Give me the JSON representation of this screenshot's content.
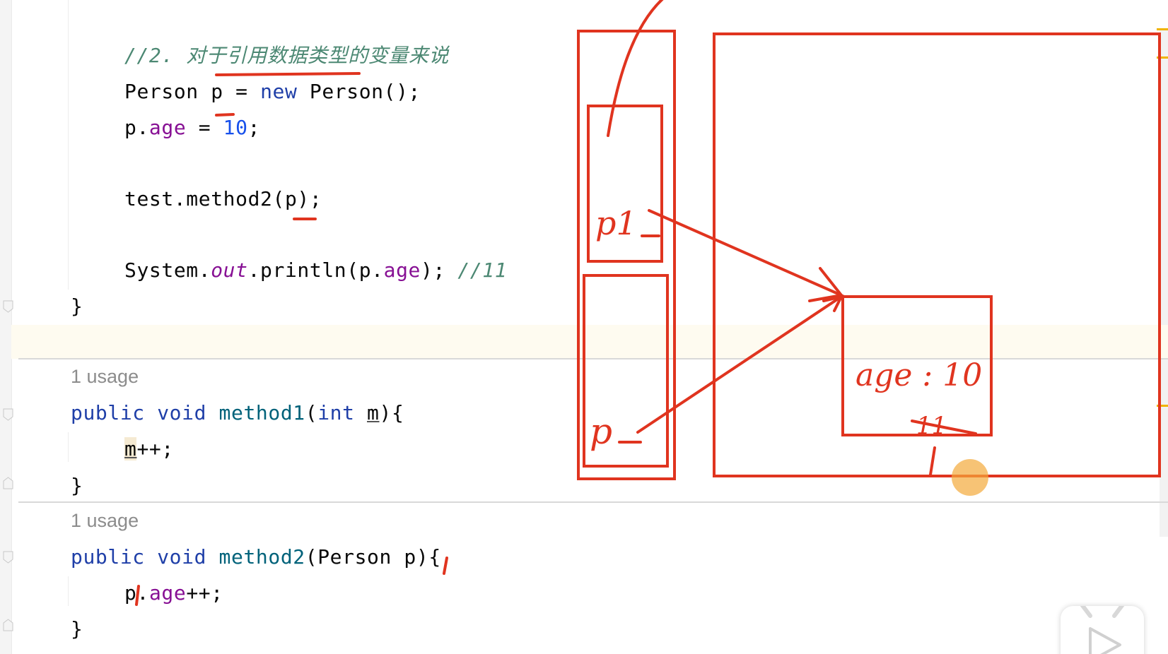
{
  "editor": {
    "comment_line": "//2. 对于引用数据类型的变量来说",
    "line_person": {
      "type": "Person",
      "var": "p",
      "eq": " = ",
      "kw_new": "new",
      "ctor": " Person();"
    },
    "line_age": {
      "obj": "p.",
      "field": "age",
      "eq": " = ",
      "num": "10",
      "end": ";"
    },
    "line_call": "test.method2(p);",
    "line_print": {
      "pre": "System.",
      "out": "out",
      "mid": ".println(p.",
      "field": "age",
      "post": "); ",
      "comment": "//11"
    },
    "brace_close_1": "}",
    "usage_1": "1 usage",
    "method1": {
      "kw_public": "public",
      "kw_void": "void",
      "name": "method1",
      "open": "(",
      "kw_int": "int",
      "param": "m",
      "close": "){"
    },
    "m_inc": {
      "var": "m",
      "op": "++;"
    },
    "brace_close_2": "}",
    "usage_2": "1 usage",
    "method2": {
      "kw_public": "public",
      "kw_void": "void",
      "name": "method2",
      "open": "(Person ",
      "param": "p",
      "close": "){"
    },
    "p_inc": {
      "obj": "p",
      "dot": ".",
      "field": "age",
      "op": "++;"
    },
    "brace_close_3": "}"
  },
  "annotations": {
    "color": "#e0341f",
    "label_p1": "p1",
    "label_p": "p",
    "label_age": "age : 10",
    "label_11": "11"
  },
  "colors": {
    "keyword": "#1f3fa8",
    "field": "#871094",
    "number": "#1750eb",
    "comment": "#4c8873",
    "method_name": "#00627a",
    "usage": "#8c8c8c"
  },
  "icons": {
    "play": "play-icon",
    "fold": "fold-marker-icon"
  }
}
